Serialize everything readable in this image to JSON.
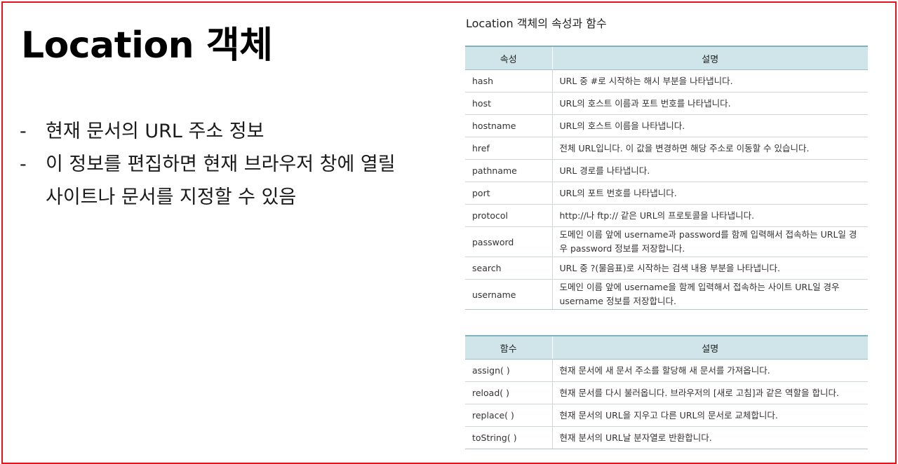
{
  "slide": {
    "title": "Location 객체",
    "bullets": [
      {
        "marker": "-",
        "text": "현재 문서의 URL 주소 정보"
      },
      {
        "marker": "-",
        "text": "이 정보를 편집하면 현재 브라우저 창에 열릴 사이트나 문서를 지정할 수 있음"
      }
    ]
  },
  "panel": {
    "title": "Location 객체의 속성과 함수",
    "properties": {
      "headers": [
        "속성",
        "설명"
      ],
      "rows": [
        {
          "name": "hash",
          "desc": "URL 중 #로 시작하는 해시 부분을 나타냅니다."
        },
        {
          "name": "host",
          "desc": "URL의 호스트 이름과 포트 번호를 나타냅니다."
        },
        {
          "name": "hostname",
          "desc": "URL의 호스트 이름을 나타냅니다."
        },
        {
          "name": "href",
          "desc": "전체 URL입니다. 이 값을 변경하면 해당 주소로 이동할 수 있습니다."
        },
        {
          "name": "pathname",
          "desc": "URL 경로를 나타냅니다."
        },
        {
          "name": "port",
          "desc": "URL의 포트 번호를 나타냅니다."
        },
        {
          "name": "protocol",
          "desc": "http://나 ftp:// 같은 URL의 프로토콜을 나타냅니다."
        },
        {
          "name": "password",
          "desc": "도메인 이름 앞에 username과 password를 함께 입력해서 접속하는 URL일 경우 password 정보를 저장합니다."
        },
        {
          "name": "search",
          "desc": "URL 중 ?(물음표)로 시작하는 검색 내용 부분을 나타냅니다."
        },
        {
          "name": "username",
          "desc": "도메인 이름 앞에 username을 함께 입력해서 접속하는 사이트 URL일 경우 username 정보를 저장합니다."
        }
      ]
    },
    "functions": {
      "headers": [
        "함수",
        "설명"
      ],
      "rows": [
        {
          "name": "assign( )",
          "desc": "현재 문서에 새 문서 주소를 할당해 새 문서를 가져옵니다."
        },
        {
          "name": "reload( )",
          "desc": "현재 문서를 다시 불러옵니다. 브라우저의 [새로 고침]과 같은 역할을 합니다."
        },
        {
          "name": "replace( )",
          "desc": "현재 문서의 URL을 지우고 다른 URL의 문서로 교체합니다."
        },
        {
          "name": "toString( )",
          "desc": "현재 분서의 URL날 분자열로 반환합니다."
        }
      ]
    }
  },
  "colors": {
    "frame_border": "#e3141b",
    "table_header_bg": "#cfe5ea",
    "table_header_border": "#7fb3c0"
  }
}
